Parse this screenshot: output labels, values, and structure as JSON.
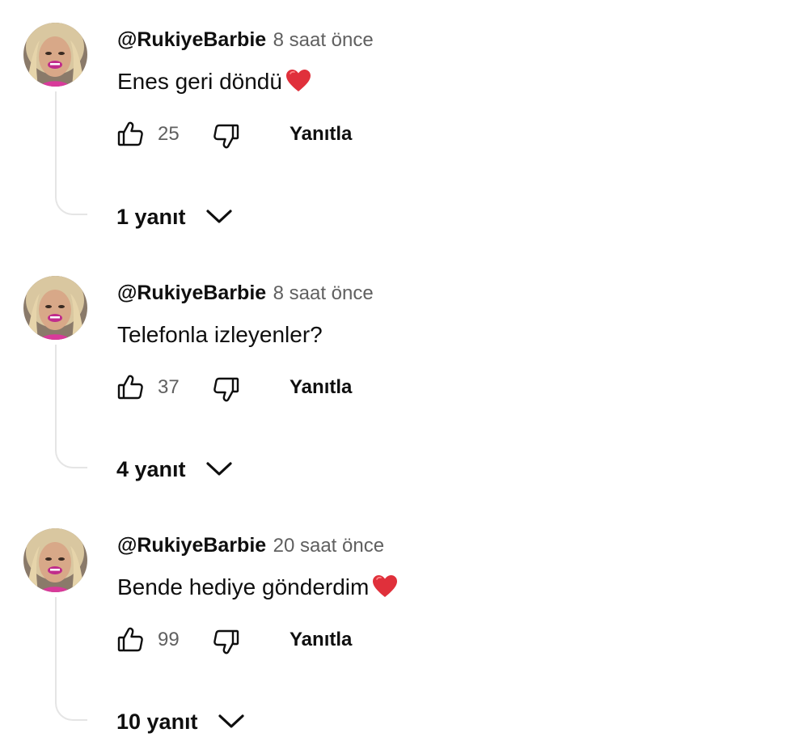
{
  "comments": [
    {
      "username": "@RukiyeBarbie",
      "timestamp": "8 saat önce",
      "text": "Enes geri döndü",
      "has_heart": true,
      "likes": "25",
      "reply_label": "Yanıtla",
      "replies_label": "1 yanıt"
    },
    {
      "username": "@RukiyeBarbie",
      "timestamp": "8 saat önce",
      "text": "Telefonla izleyenler?",
      "has_heart": false,
      "likes": "37",
      "reply_label": "Yanıtla",
      "replies_label": "4 yanıt"
    },
    {
      "username": "@RukiyeBarbie",
      "timestamp": "20 saat önce",
      "text": "Bende hediye gönderdim",
      "has_heart": true,
      "likes": "99",
      "reply_label": "Yanıtla",
      "replies_label": "10 yanıt"
    }
  ],
  "icons": {
    "like": "thumbs-up-icon",
    "dislike": "thumbs-down-icon",
    "heart": "red-heart-emoji",
    "expand": "chevron-down-icon"
  },
  "colors": {
    "text_primary": "#0f0f0f",
    "text_secondary": "#606060",
    "thread_line": "#e5e5e5",
    "heart": "#e0303b"
  }
}
